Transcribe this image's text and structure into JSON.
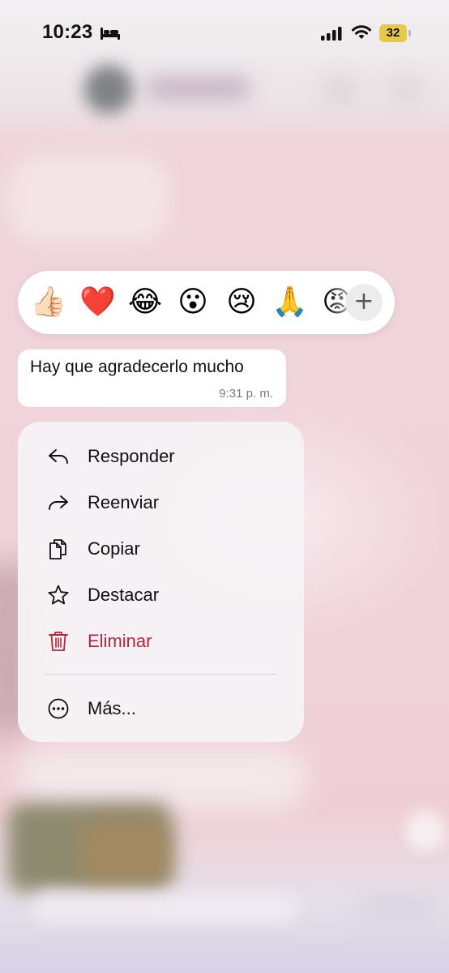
{
  "status_bar": {
    "time": "10:23",
    "battery_level": "32",
    "battery_color": "#e6c94a",
    "icons": [
      "bed-icon",
      "signal-icon",
      "wifi-icon",
      "battery-icon"
    ]
  },
  "reactions": {
    "emojis": [
      "👍🏻",
      "❤️",
      "😂",
      "😮",
      "😢",
      "🙏",
      "😡"
    ],
    "more_label": "+"
  },
  "message": {
    "text": "Hay que agradecerlo mucho",
    "time": "9:31 p. m."
  },
  "menu": {
    "items": [
      {
        "label": "Responder",
        "icon": "reply-icon"
      },
      {
        "label": "Reenviar",
        "icon": "forward-icon"
      },
      {
        "label": "Copiar",
        "icon": "copy-icon"
      },
      {
        "label": "Destacar",
        "icon": "star-icon"
      },
      {
        "label": "Eliminar",
        "icon": "trash-icon",
        "color": "#b3263f"
      },
      {
        "label": "Más...",
        "icon": "more-icon"
      }
    ]
  },
  "colors": {
    "background": "#efd3d9",
    "danger": "#b3263f"
  }
}
